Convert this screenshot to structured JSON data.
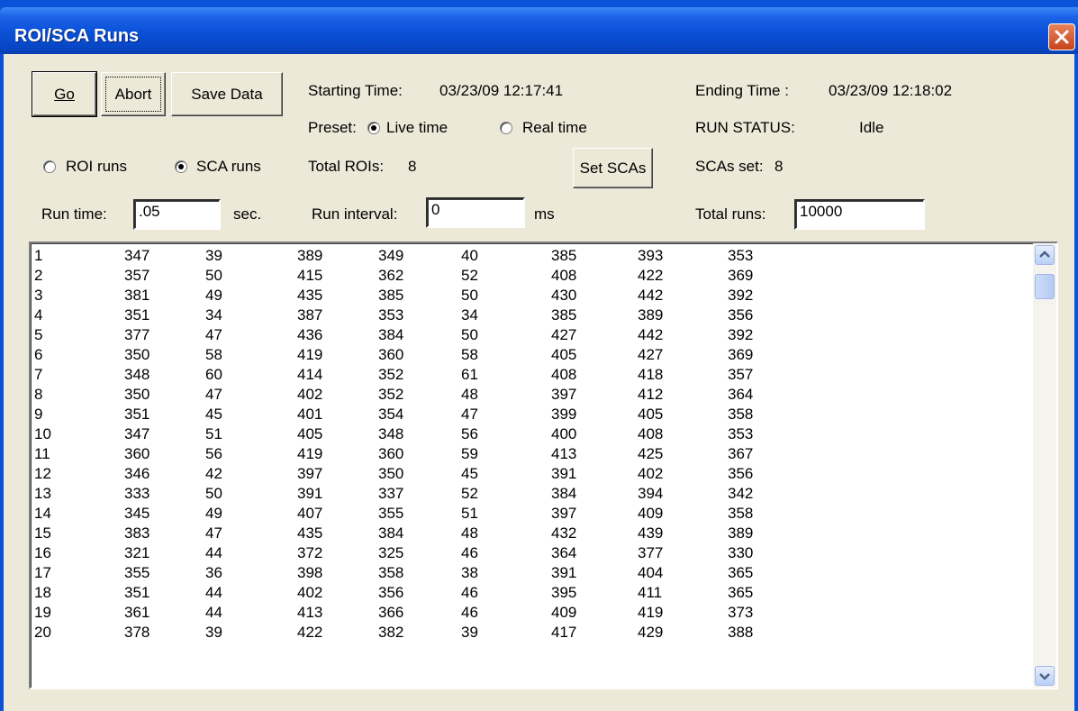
{
  "window": {
    "title": "ROI/SCA Runs"
  },
  "buttons": {
    "go": "Go",
    "abort": "Abort",
    "save_data": "Save Data",
    "set_scas": "Set SCAs"
  },
  "labels": {
    "starting_time_label": "Starting Time:",
    "starting_time_value": "03/23/09  12:17:41",
    "ending_time_label": "Ending Time :",
    "ending_time_value": "03/23/09  12:18:02",
    "preset_label": "Preset:",
    "run_status_label": "RUN STATUS:",
    "run_status_value": "Idle",
    "total_rois_label": "Total ROIs:",
    "total_rois_value": "8",
    "scas_set_label": "SCAs set:",
    "scas_set_value": "8",
    "run_time_label": "Run time:",
    "run_time_unit": "sec.",
    "run_interval_label": "Run interval:",
    "run_interval_unit": "ms",
    "total_runs_label": "Total runs:"
  },
  "radios": {
    "live_time": {
      "label": "Live time",
      "checked": true
    },
    "real_time": {
      "label": "Real time",
      "checked": false
    },
    "roi_runs": {
      "label": "ROI runs",
      "checked": false
    },
    "sca_runs": {
      "label": "SCA runs",
      "checked": true
    }
  },
  "inputs": {
    "run_time": ".05",
    "run_interval": "0",
    "total_runs": "10000"
  },
  "list_rows": [
    [
      "1",
      "347",
      "39",
      "389",
      "349",
      "40",
      "385",
      "393",
      "353"
    ],
    [
      "2",
      "357",
      "50",
      "415",
      "362",
      "52",
      "408",
      "422",
      "369"
    ],
    [
      "3",
      "381",
      "49",
      "435",
      "385",
      "50",
      "430",
      "442",
      "392"
    ],
    [
      "4",
      "351",
      "34",
      "387",
      "353",
      "34",
      "385",
      "389",
      "356"
    ],
    [
      "5",
      "377",
      "47",
      "436",
      "384",
      "50",
      "427",
      "442",
      "392"
    ],
    [
      "6",
      "350",
      "58",
      "419",
      "360",
      "58",
      "405",
      "427",
      "369"
    ],
    [
      "7",
      "348",
      "60",
      "414",
      "352",
      "61",
      "408",
      "418",
      "357"
    ],
    [
      "8",
      "350",
      "47",
      "402",
      "352",
      "48",
      "397",
      "412",
      "364"
    ],
    [
      "9",
      "351",
      "45",
      "401",
      "354",
      "47",
      "399",
      "405",
      "358"
    ],
    [
      "10",
      "347",
      "51",
      "405",
      "348",
      "56",
      "400",
      "408",
      "353"
    ],
    [
      "11",
      "360",
      "56",
      "419",
      "360",
      "59",
      "413",
      "425",
      "367"
    ],
    [
      "12",
      "346",
      "42",
      "397",
      "350",
      "45",
      "391",
      "402",
      "356"
    ],
    [
      "13",
      "333",
      "50",
      "391",
      "337",
      "52",
      "384",
      "394",
      "342"
    ],
    [
      "14",
      "345",
      "49",
      "407",
      "355",
      "51",
      "397",
      "409",
      "358"
    ],
    [
      "15",
      "383",
      "47",
      "435",
      "384",
      "48",
      "432",
      "439",
      "389"
    ],
    [
      "16",
      "321",
      "44",
      "372",
      "325",
      "46",
      "364",
      "377",
      "330"
    ],
    [
      "17",
      "355",
      "36",
      "398",
      "358",
      "38",
      "391",
      "404",
      "365"
    ],
    [
      "18",
      "351",
      "44",
      "402",
      "356",
      "46",
      "395",
      "411",
      "365"
    ],
    [
      "19",
      "361",
      "44",
      "413",
      "366",
      "46",
      "409",
      "419",
      "373"
    ],
    [
      "20",
      "378",
      "39",
      "422",
      "382",
      "39",
      "417",
      "429",
      "388"
    ]
  ]
}
